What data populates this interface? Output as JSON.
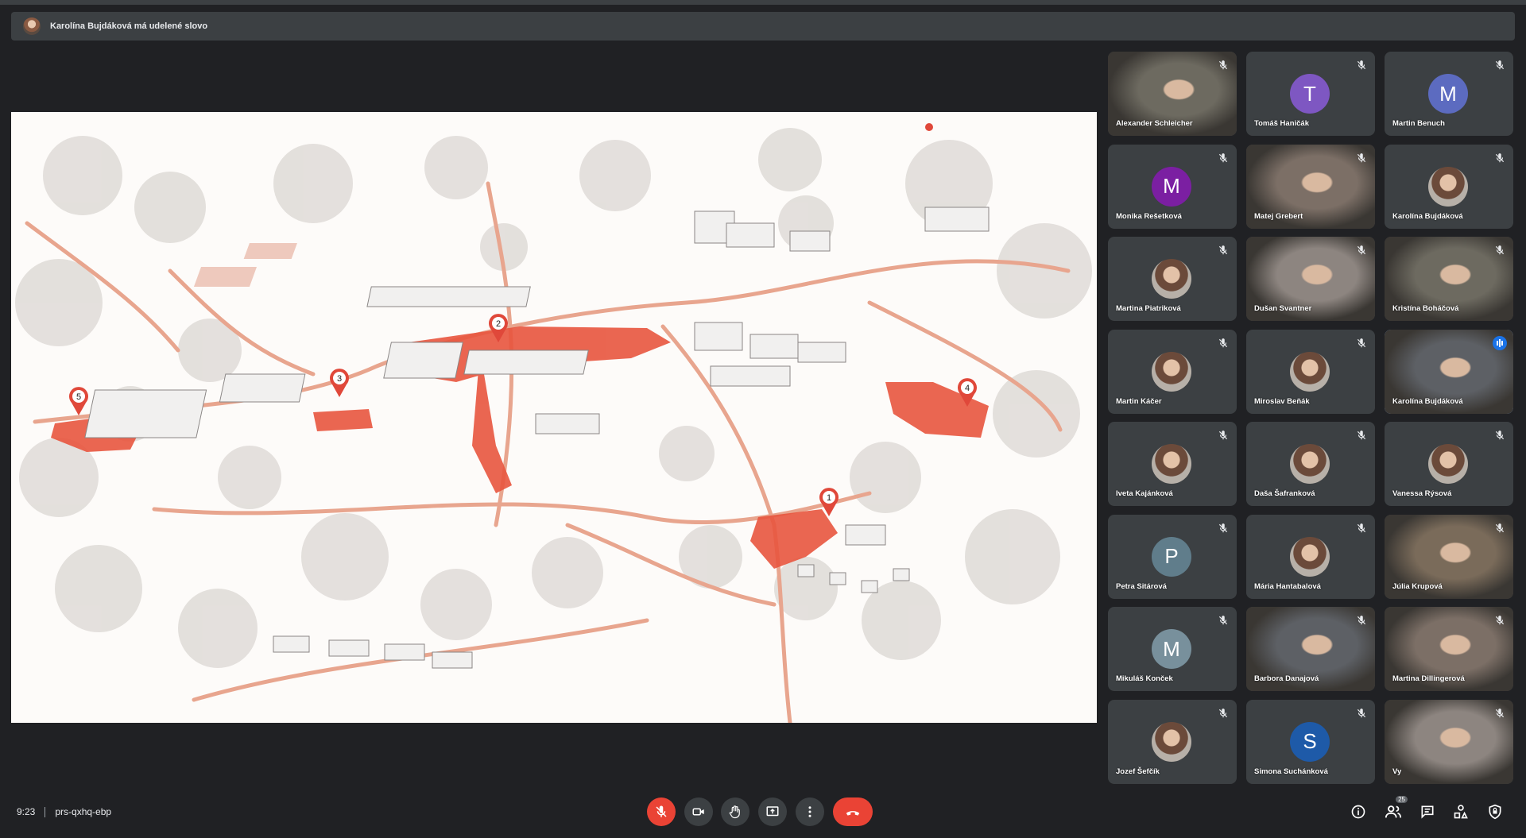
{
  "banner": {
    "text": "Karolína Bujdáková má udelené slovo"
  },
  "map": {
    "markers": [
      "1",
      "2",
      "3",
      "4",
      "5"
    ]
  },
  "participants": [
    {
      "name": "Alexander Schleicher",
      "kind": "camera",
      "muted": true
    },
    {
      "name": "Tomáš Haničák",
      "kind": "letter",
      "letter": "T",
      "color": "#7e57c2",
      "muted": true
    },
    {
      "name": "Martin Benuch",
      "kind": "letter",
      "letter": "M",
      "color": "#5c6bc0",
      "muted": true
    },
    {
      "name": "Monika Rešetková",
      "kind": "letter",
      "letter": "M",
      "color": "#7b1fa2",
      "muted": true
    },
    {
      "name": "Matej Grebert",
      "kind": "camera",
      "muted": true
    },
    {
      "name": "Karolína Bujdáková",
      "kind": "photo",
      "muted": true
    },
    {
      "name": "Martina Piatriková",
      "kind": "photo",
      "muted": true
    },
    {
      "name": "Dušan Svantner",
      "kind": "camera",
      "muted": true
    },
    {
      "name": "Kristína Boháčová",
      "kind": "camera",
      "muted": true
    },
    {
      "name": "Martin Káčer",
      "kind": "photo",
      "muted": true
    },
    {
      "name": "Miroslav Beňák",
      "kind": "photo",
      "muted": true
    },
    {
      "name": "Karolína Bujdáková",
      "kind": "camera",
      "muted": false,
      "speaking": true
    },
    {
      "name": "Iveta Kajánková",
      "kind": "photo",
      "muted": true
    },
    {
      "name": "Daša Šafranková",
      "kind": "photo",
      "muted": true
    },
    {
      "name": "Vanessa Rýsová",
      "kind": "photo",
      "muted": true
    },
    {
      "name": "Petra Sitárová",
      "kind": "letter",
      "letter": "P",
      "color": "#607d8b",
      "muted": true
    },
    {
      "name": "Mária Hantabalová",
      "kind": "photo",
      "muted": true
    },
    {
      "name": "Júlia Krupová",
      "kind": "camera",
      "muted": true
    },
    {
      "name": "Mikuláš Konček",
      "kind": "letter",
      "letter": "M",
      "color": "#78909c",
      "muted": true
    },
    {
      "name": "Barbora Danajová",
      "kind": "camera",
      "muted": true
    },
    {
      "name": "Martina Dillingerová",
      "kind": "camera",
      "muted": true
    },
    {
      "name": "Jozef Šefčík",
      "kind": "photo",
      "muted": true
    },
    {
      "name": "Simona Suchánková",
      "kind": "letter",
      "letter": "S",
      "color": "#1e5aa8",
      "muted": true
    },
    {
      "name": "Vy",
      "kind": "camera",
      "muted": true
    }
  ],
  "footer": {
    "time": "9:23",
    "meeting_code": "prs-qxhq-ebp",
    "people_count": "25"
  },
  "icons": [
    "mic-off-icon",
    "camera-icon",
    "hand-icon",
    "present-icon",
    "more-icon",
    "leave-call-icon",
    "info-icon",
    "people-icon",
    "chat-icon",
    "activities-icon",
    "host-controls-icon"
  ]
}
